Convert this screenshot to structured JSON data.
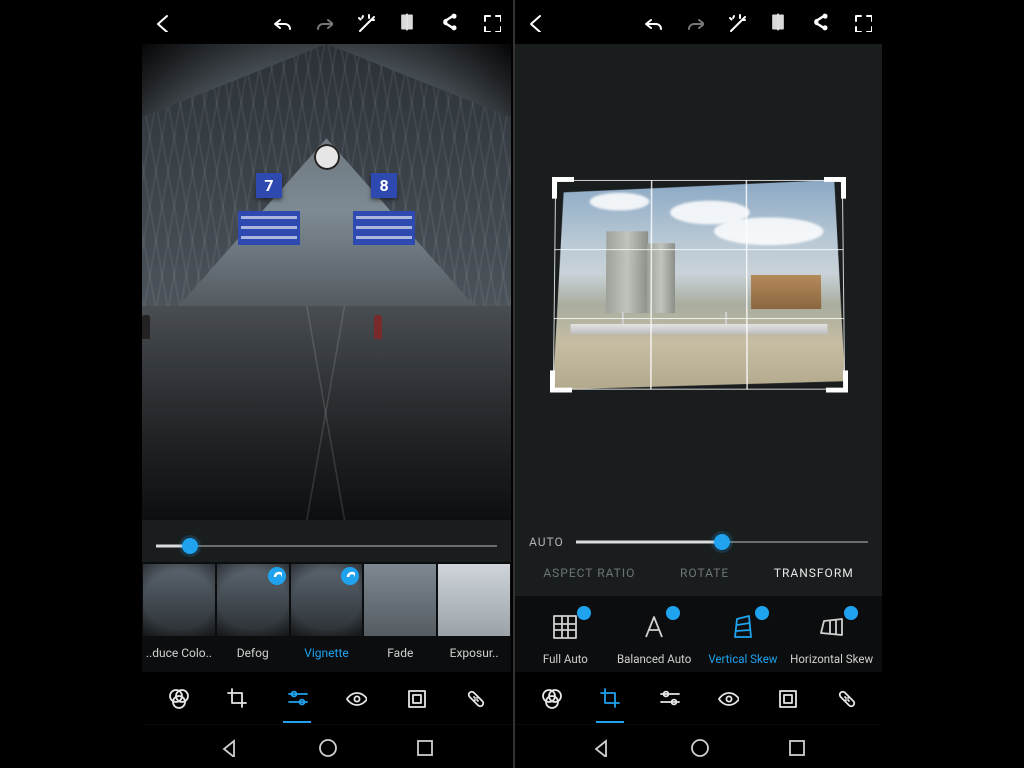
{
  "accent": "#1fa3ef",
  "topbar": {
    "back_icon": "arrow-left",
    "undo_icon": "undo",
    "redo_icon": "redo",
    "magic_icon": "magic-wand",
    "compare_icon": "flip-compare",
    "share_icon": "share",
    "fullscreen_icon": "fullscreen"
  },
  "left": {
    "slider_percent": 10,
    "image_scene": {
      "subject": "train station interior",
      "platform_signs": [
        "7",
        "8"
      ]
    },
    "filter_labels": [
      "..duce Colo..",
      "Defog",
      "Vignette",
      "Fade",
      "Exposur.."
    ],
    "filter_active_index": 2,
    "filter_thumb_badges": [
      false,
      true,
      true,
      false,
      false
    ],
    "bottom_active_index": 2
  },
  "right": {
    "slider_label": "AUTO",
    "slider_percent": 50,
    "seg_tabs": [
      "ASPECT RATIO",
      "ROTATE",
      "TRANSFORM"
    ],
    "seg_active_index": 2,
    "tools": [
      {
        "label": "Full Auto",
        "icon": "grid-auto",
        "badge": true
      },
      {
        "label": "Balanced Auto",
        "icon": "letter-A",
        "badge": true
      },
      {
        "label": "Vertical Skew",
        "icon": "skew-vertical",
        "badge": true,
        "active": true
      },
      {
        "label": "Horizontal Skew",
        "icon": "skew-horizontal",
        "badge": true
      }
    ],
    "bottom_active_index": 1
  },
  "bottom_nav_icons": [
    "looks",
    "crop",
    "adjust-sliders",
    "eye",
    "frame",
    "heal-bandage"
  ],
  "sysbar_icons": [
    "nav-back",
    "nav-home",
    "nav-recent"
  ]
}
